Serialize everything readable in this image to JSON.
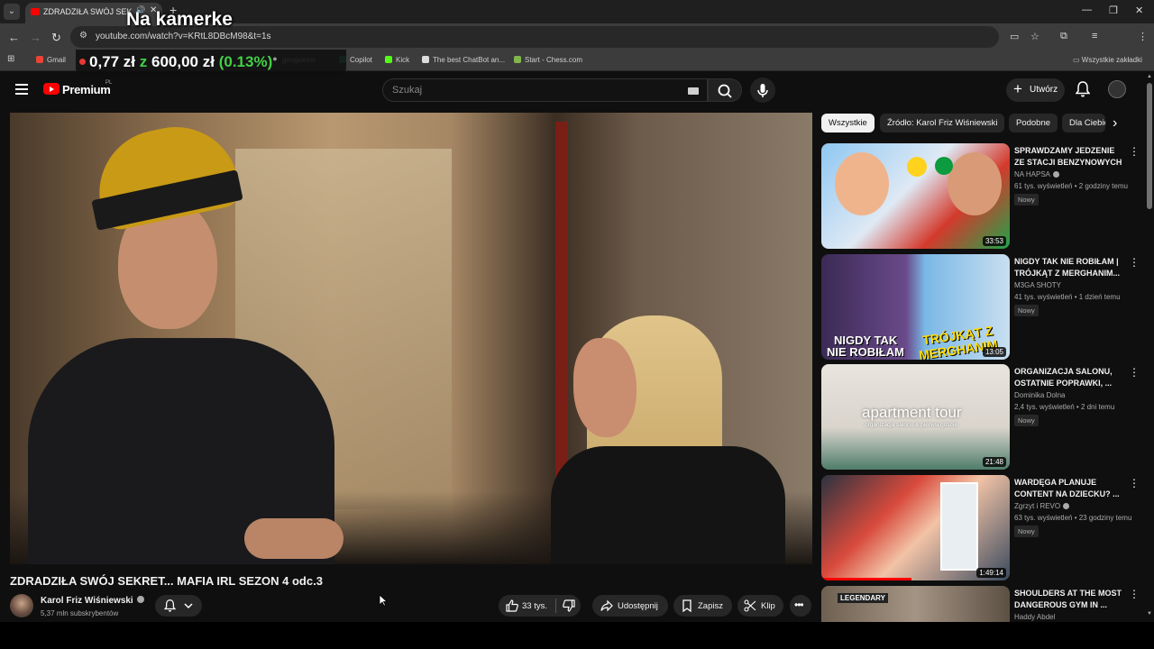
{
  "browser": {
    "tab_title": "ZDRADZIŁA SWÓJ SEKRET...",
    "url": "youtube.com/watch?v=KRtL8DBcM98&t=1s",
    "bookmarks": [
      {
        "label": "Gmail",
        "color": "#ea4335"
      },
      {
        "label": "geoguessr",
        "color": "#7b61ff"
      },
      {
        "label": "Copilot",
        "color": "#19a974"
      },
      {
        "label": "Kick",
        "color": "#53fc18"
      },
      {
        "label": "The best ChatBot an...",
        "color": "#dddddd"
      },
      {
        "label": "Start - Chess.com",
        "color": "#81b64c"
      }
    ],
    "all_bookmarks": "Wszystkie zakładki"
  },
  "overlay": {
    "title": "Na kamerke",
    "ticker_value": "0,77 zł",
    "ticker_of": "z",
    "ticker_goal": "600,00 zł",
    "ticker_percent": "(0.13%)"
  },
  "youtube": {
    "logo_text": "Premium",
    "country": "PL",
    "search_placeholder": "Szukaj",
    "create_label": "Utwórz"
  },
  "video": {
    "title": "ZDRADZIŁA SWÓJ SEKRET... MAFIA IRL SEZON 4 odc.3",
    "channel": "Karol Friz Wiśniewski",
    "subscribers": "5,37 mln subskrybentów",
    "likes": "33 tys.",
    "share_label": "Udostępnij",
    "save_label": "Zapisz",
    "clip_label": "Klip"
  },
  "chips": [
    "Wszystkie",
    "Źródło: Karol Friz Wiśniewski",
    "Podobne",
    "Dla Ciebie"
  ],
  "recommendations": [
    {
      "title": "SPRAWDZAMY JEDZENIE ZE STACJI BENZYNOWYCH",
      "channel": "NA HAPSA",
      "verified": true,
      "meta": "61 tys. wyświetleń • 2 godziny temu",
      "badge": "Nowy",
      "duration": "33:53",
      "thumb_texts": []
    },
    {
      "title": "NIGDY TAK NIE ROBIŁAM | TRÓJKĄT Z MERGHANIM...",
      "channel": "M3GA SHOTY",
      "verified": false,
      "meta": "41 tys. wyświetleń • 1 dzień temu",
      "badge": "Nowy",
      "duration": "13:05",
      "thumb_texts": [
        "NIGDY TAK",
        "NIE ROBIŁAM",
        "TRÓJKĄT Z",
        "MERGHANIM"
      ]
    },
    {
      "title": "ORGANIZACJA SALONU, OSTATNIE POPRAWKI, ...",
      "channel": "Dominika Dolna",
      "verified": false,
      "meta": "2,4 tys. wyświetleń • 2 dni temu",
      "badge": "Nowy",
      "duration": "21:48",
      "thumb_texts": [
        "apartment tour",
        "organizacja salonu & pierwsi goście"
      ]
    },
    {
      "title": "WARDĘGA PLANUJE CONTENT NA DZIECKU? ...",
      "channel": "Zgrzyt i REVO",
      "verified": true,
      "meta": "63 tys. wyświetleń • 23 godziny temu",
      "badge": "Nowy",
      "duration": "1:49:14",
      "thumb_texts": []
    },
    {
      "title": "SHOULDERS AT THE MOST DANGEROUS GYM IN ...",
      "channel": "Haddy Abdel",
      "verified": false,
      "meta": "",
      "badge": "",
      "duration": "",
      "thumb_texts": [
        "LEGENDARY"
      ]
    }
  ]
}
